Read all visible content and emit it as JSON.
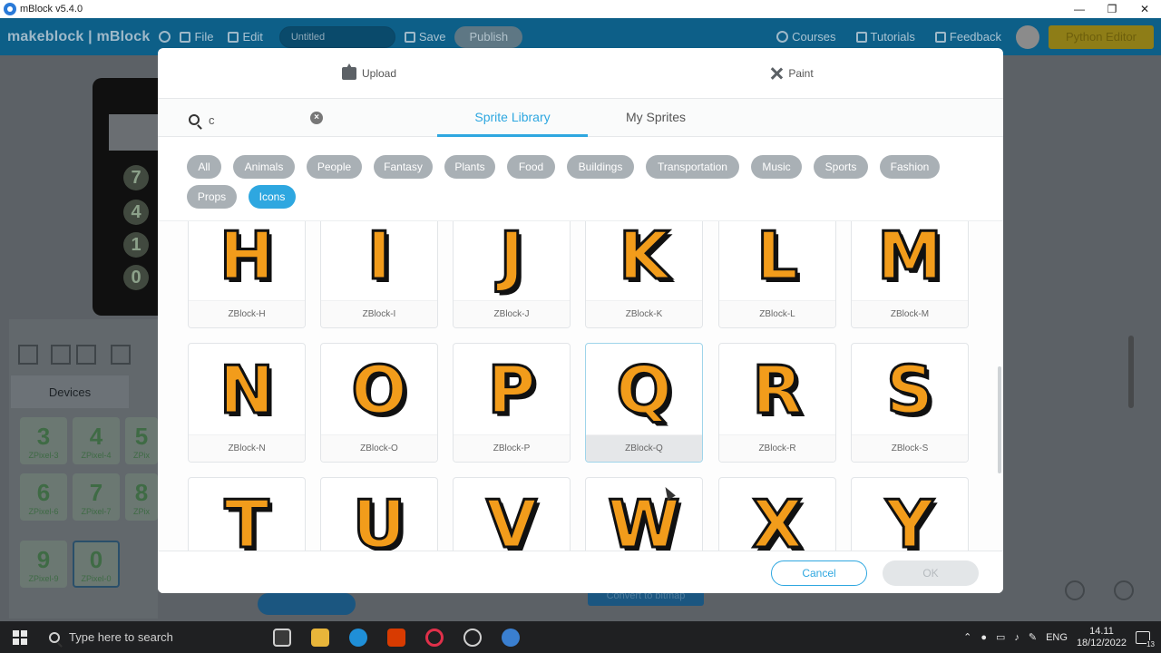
{
  "window": {
    "title": "mBlock v5.4.0",
    "controls": [
      "—",
      "❐",
      "✕"
    ]
  },
  "appbar": {
    "brand": "makeblock | mBlock",
    "file_label": "File",
    "edit_label": "Edit",
    "project_name": "Untitled",
    "save_label": "Save",
    "publish_label": "Publish",
    "courses_label": "Courses",
    "tutorials_label": "Tutorials",
    "feedback_label": "Feedback",
    "python_editor_label": "Python Editor"
  },
  "background": {
    "stage_keys": [
      "7",
      "4",
      "1",
      "0"
    ],
    "devices_tab": "Devices",
    "device_tiles": [
      {
        "glyph": "3",
        "name": "ZPixel-3"
      },
      {
        "glyph": "4",
        "name": "ZPixel-4"
      },
      {
        "glyph": "5",
        "name": "ZPix"
      },
      {
        "glyph": "6",
        "name": "ZPixel-6"
      },
      {
        "glyph": "7",
        "name": "ZPixel-7"
      },
      {
        "glyph": "8",
        "name": "ZPix"
      },
      {
        "glyph": "9",
        "name": "ZPixel-9"
      },
      {
        "glyph": "0",
        "name": "ZPixel-0"
      }
    ],
    "convert_label": "Convert to bitmap"
  },
  "modal": {
    "upload_label": "Upload",
    "paint_label": "Paint",
    "search": {
      "value": "c",
      "placeholder": ""
    },
    "tabs": [
      {
        "label": "Sprite Library",
        "active": true
      },
      {
        "label": "My Sprites",
        "active": false
      }
    ],
    "categories": [
      {
        "label": "All",
        "active": false
      },
      {
        "label": "Animals",
        "active": false
      },
      {
        "label": "People",
        "active": false
      },
      {
        "label": "Fantasy",
        "active": false
      },
      {
        "label": "Plants",
        "active": false
      },
      {
        "label": "Food",
        "active": false
      },
      {
        "label": "Buildings",
        "active": false
      },
      {
        "label": "Transportation",
        "active": false
      },
      {
        "label": "Music",
        "active": false
      },
      {
        "label": "Sports",
        "active": false
      },
      {
        "label": "Fashion",
        "active": false
      },
      {
        "label": "Props",
        "active": false
      },
      {
        "label": "Icons",
        "active": true
      }
    ],
    "sprites": [
      {
        "glyph": "H",
        "name": "ZBlock-H"
      },
      {
        "glyph": "I",
        "name": "ZBlock-I"
      },
      {
        "glyph": "J",
        "name": "ZBlock-J"
      },
      {
        "glyph": "K",
        "name": "ZBlock-K"
      },
      {
        "glyph": "L",
        "name": "ZBlock-L"
      },
      {
        "glyph": "M",
        "name": "ZBlock-M"
      },
      {
        "glyph": "N",
        "name": "ZBlock-N"
      },
      {
        "glyph": "O",
        "name": "ZBlock-O"
      },
      {
        "glyph": "P",
        "name": "ZBlock-P"
      },
      {
        "glyph": "Q",
        "name": "ZBlock-Q",
        "selected": true
      },
      {
        "glyph": "R",
        "name": "ZBlock-R"
      },
      {
        "glyph": "S",
        "name": "ZBlock-S"
      },
      {
        "glyph": "T",
        "name": ""
      },
      {
        "glyph": "U",
        "name": ""
      },
      {
        "glyph": "V",
        "name": ""
      },
      {
        "glyph": "W",
        "name": ""
      },
      {
        "glyph": "X",
        "name": ""
      },
      {
        "glyph": "Y",
        "name": ""
      }
    ],
    "cancel_label": "Cancel",
    "ok_label": "OK"
  },
  "taskbar": {
    "search_placeholder": "Type here to search",
    "language": "ENG",
    "time": "14.11",
    "date": "18/12/2022",
    "notification_count": "13"
  },
  "colors": {
    "accent": "#2ea7e0",
    "chip": "#a9b0b5",
    "sprite_fill": "#f29c1b",
    "appbar": "#0d5f88"
  }
}
